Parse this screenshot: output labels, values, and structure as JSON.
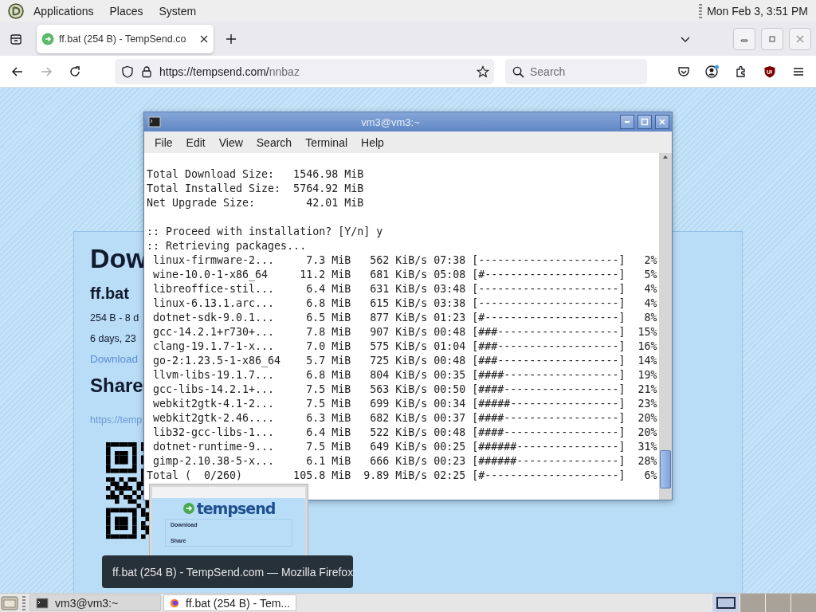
{
  "top_panel": {
    "menus": [
      "Applications",
      "Places",
      "System"
    ],
    "clock": "Mon Feb 3, 3:51 PM"
  },
  "browser": {
    "tabs": [
      {
        "label": "ff.bat (254 B) - TempSend.co",
        "selected": true
      }
    ],
    "nav": {
      "forward_disabled": true
    },
    "address": {
      "base": "https://tempsend.com/",
      "path": "nnbaz"
    },
    "search": {
      "placeholder": "Search"
    }
  },
  "page": {
    "heading": "Dow",
    "file_name": "ff.bat",
    "file_info": "254 B - 8 d",
    "expiry": "6 days, 23",
    "download_link": "Download",
    "share_heading": "Share",
    "share_link": "https://temp"
  },
  "terminal": {
    "title": "vm3@vm3:~",
    "menus": [
      "File",
      "Edit",
      "View",
      "Search",
      "Terminal",
      "Help"
    ],
    "summary": [
      "Total Download Size:   1546.98 MiB",
      "Total Installed Size:  5764.92 MiB",
      "Net Upgrade Size:        42.01 MiB"
    ],
    "prompt": [
      ":: Proceed with installation? [Y/n] y",
      ":: Retrieving packages..."
    ],
    "packages": [
      " linux-firmware-2...     7.3 MiB   562 KiB/s 07:38 [----------------------]   2%",
      " wine-10.0-1-x86_64     11.2 MiB   681 KiB/s 05:08 [#---------------------]   5%",
      " libreoffice-stil...     6.4 MiB   631 KiB/s 03:48 [----------------------]   4%",
      " linux-6.13.1.arc...     6.8 MiB   615 KiB/s 03:38 [----------------------]   4%",
      " dotnet-sdk-9.0.1...     6.5 MiB   877 KiB/s 01:23 [#---------------------]   8%",
      " gcc-14.2.1+r730+...     7.8 MiB   907 KiB/s 00:48 [###-------------------]  15%",
      " clang-19.1.7-1-x...     7.0 MiB   575 KiB/s 01:04 [###-------------------]  16%",
      " go-2:1.23.5-1-x86_64    5.7 MiB   725 KiB/s 00:48 [###-------------------]  14%",
      " llvm-libs-19.1.7...     6.8 MiB   804 KiB/s 00:35 [####------------------]  19%",
      " gcc-libs-14.2.1+...     7.5 MiB   563 KiB/s 00:50 [####------------------]  21%",
      " webkit2gtk-4.1-2...     7.5 MiB   699 KiB/s 00:34 [#####-----------------]  23%",
      " webkit2gtk-2.46....     6.3 MiB   682 KiB/s 00:37 [####------------------]  20%",
      " lib32-gcc-libs-1...     6.4 MiB   522 KiB/s 00:48 [####------------------]  20%",
      " dotnet-runtime-9...     7.5 MiB   649 KiB/s 00:25 [######----------------]  31%",
      " gimp-2.10.38-5-x...     6.1 MiB   666 KiB/s 00:23 [######----------------]  28%"
    ],
    "total": "Total (  0/260)        105.8 MiB  9.89 MiB/s 02:25 [#---------------------]   6%"
  },
  "preview": {
    "logo": "tempsend",
    "heading": "Download",
    "share": "Share"
  },
  "tooltip": "ff.bat (254 B) - TempSend.com — Mozilla Firefox",
  "taskbar": {
    "buttons": [
      {
        "label": "vm3@vm3:~",
        "kind": "terminal",
        "selected": false
      },
      {
        "label": "ff.bat (254 B) - Tem...",
        "kind": "browser",
        "selected": true
      }
    ],
    "workspaces": [
      {
        "selected": true
      },
      {
        "selected": false
      },
      {
        "selected": false
      },
      {
        "selected": false
      }
    ]
  }
}
